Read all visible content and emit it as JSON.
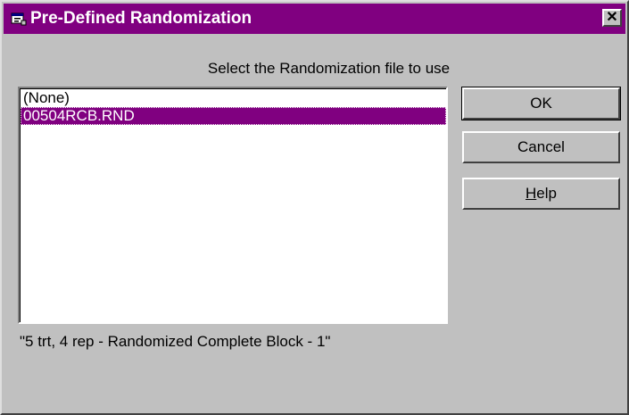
{
  "window": {
    "title": "Pre-Defined Randomization",
    "title_icon": "app-window-icon",
    "close_icon": "close-icon",
    "close_label": "✕",
    "title_bar_color": "#800080"
  },
  "prompt": {
    "text": "Select the Randomization file to use"
  },
  "file_list": {
    "items": [
      {
        "label": "(None)",
        "selected": false
      },
      {
        "label": "00504RCB.RND",
        "selected": true
      }
    ],
    "selection_color": "#800080"
  },
  "description": {
    "text": "\"5 trt, 4 rep - Randomized Complete Block - 1\""
  },
  "buttons": {
    "ok": "OK",
    "cancel": "Cancel",
    "help_mnemonic": "H",
    "help_rest": "elp"
  }
}
